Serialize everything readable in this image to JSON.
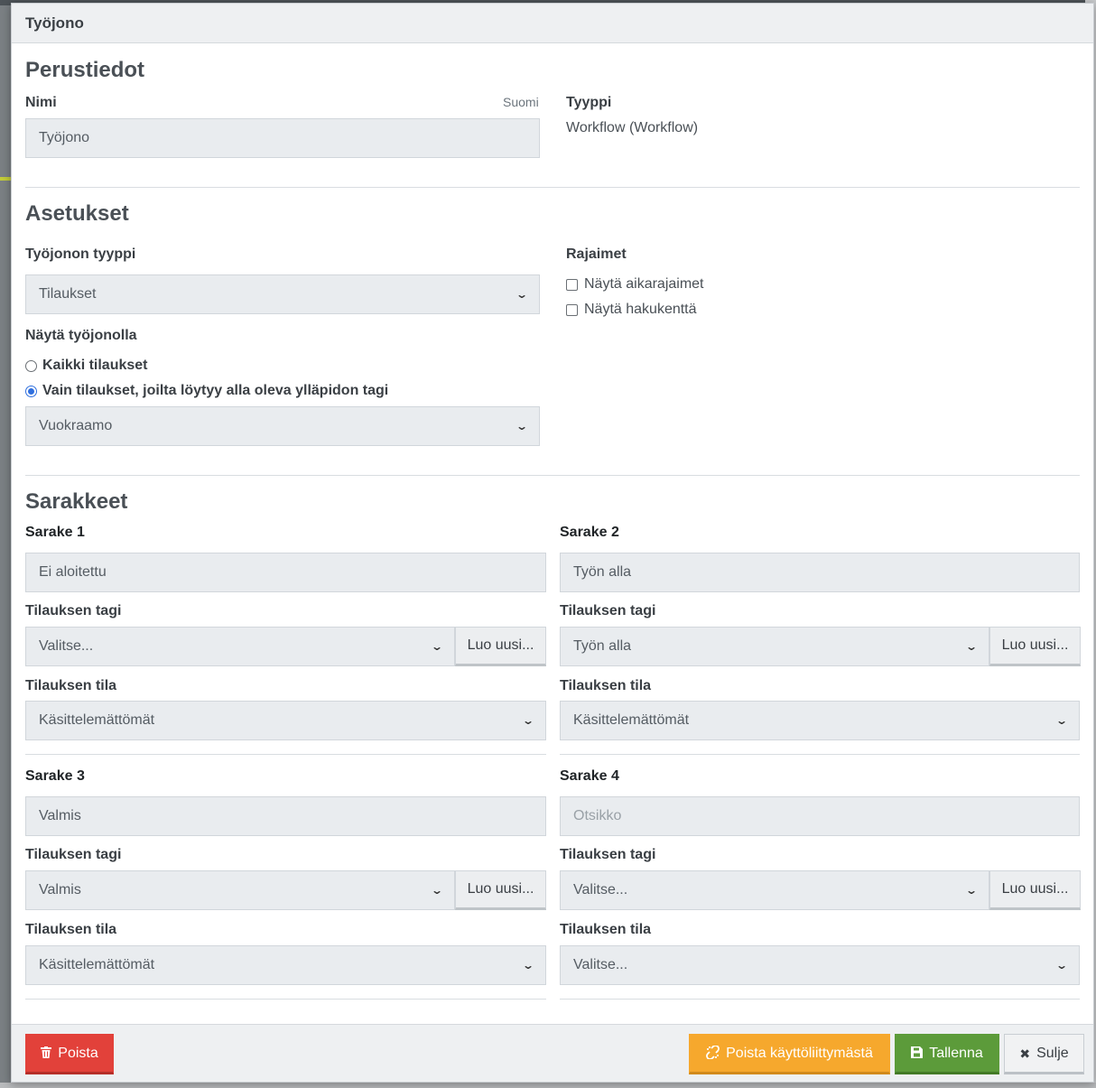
{
  "modal": {
    "title": "Työjono"
  },
  "basics": {
    "heading": "Perustiedot",
    "name_label": "Nimi",
    "lang_link": "Suomi",
    "name_value": "Työjono",
    "type_label": "Tyyppi",
    "type_value": "Workflow (Workflow)"
  },
  "settings": {
    "heading": "Asetukset",
    "queue_type_label": "Työjonon tyyppi",
    "queue_type_value": "Tilaukset",
    "show_label": "Näytä työjonolla",
    "radio_all": "Kaikki tilaukset",
    "radio_tagged": "Vain tilaukset, joilta löytyy alla oleva ylläpidon tagi",
    "radio_selected": "tagged",
    "admin_tag_value": "Vuokraamo",
    "filters_label": "Rajaimet",
    "filter_time": "Näytä aikarajaimet",
    "filter_search": "Näytä hakukenttä"
  },
  "columns": {
    "heading": "Sarakkeet",
    "tag_label": "Tilauksen tagi",
    "state_label": "Tilauksen tila",
    "new_button": "Luo uusi...",
    "items": [
      {
        "title": "Sarake 1",
        "name": "Ei aloitettu",
        "name_placeholder": false,
        "tag": "Valitse...",
        "state": "Käsittelemättömät"
      },
      {
        "title": "Sarake 2",
        "name": "Työn alla",
        "name_placeholder": false,
        "tag": "Työn alla",
        "state": "Käsittelemättömät"
      },
      {
        "title": "Sarake 3",
        "name": "Valmis",
        "name_placeholder": false,
        "tag": "Valmis",
        "state": "Käsittelemättömät"
      },
      {
        "title": "Sarake 4",
        "name": "Otsikko",
        "name_placeholder": true,
        "tag": "Valitse...",
        "state": "Valitse..."
      }
    ]
  },
  "footer": {
    "delete_label": "Poista",
    "remove_ui_label": "Poista käyttöliittymästä",
    "save_label": "Tallenna",
    "close_label": "Sulje"
  },
  "icons": {
    "trash": "trash-icon",
    "unlink": "unlink-icon",
    "save": "floppy-disk-icon",
    "close": "close-icon",
    "chevron": "chevron-down-icon"
  }
}
